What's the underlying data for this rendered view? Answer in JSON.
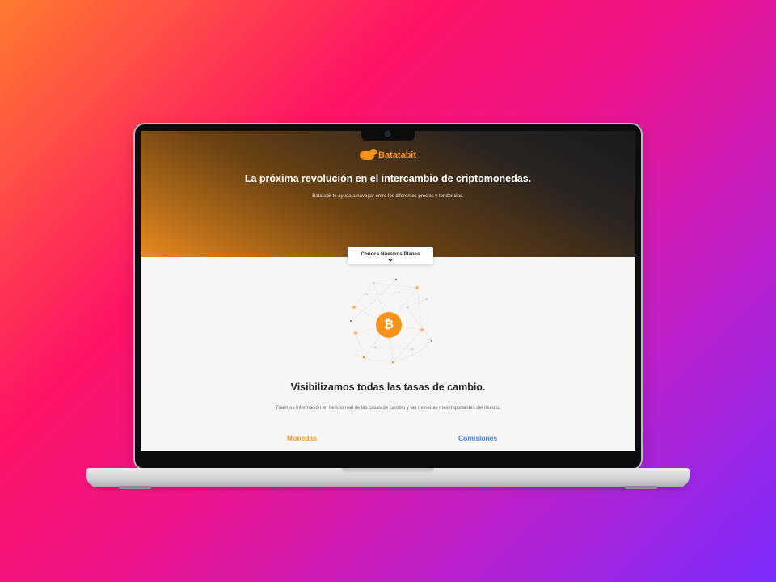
{
  "brand": {
    "name": "Batatabit",
    "accent": "#f7931a"
  },
  "hero": {
    "title": "La próxima revolución en el intercambio de criptomonedas.",
    "subtitle": "Batatabit te ayuda a navegar entre los diferentes precios y tendencias."
  },
  "cta": {
    "label": "Conoce Nuestros Planes",
    "icon": "chevron-down-icon"
  },
  "illustration": {
    "coin_symbol": "₿",
    "icon": "bitcoin-icon"
  },
  "section": {
    "title": "Visibilizamos todas las tasas de cambio.",
    "subtitle": "Traemos información en tiempo real de las casas de cambio y las monedas más importantes del mundo."
  },
  "tabs": [
    {
      "label": "Monedas",
      "color": "#f7931a"
    },
    {
      "label": "Comisiones",
      "color": "#2f80ed"
    }
  ]
}
